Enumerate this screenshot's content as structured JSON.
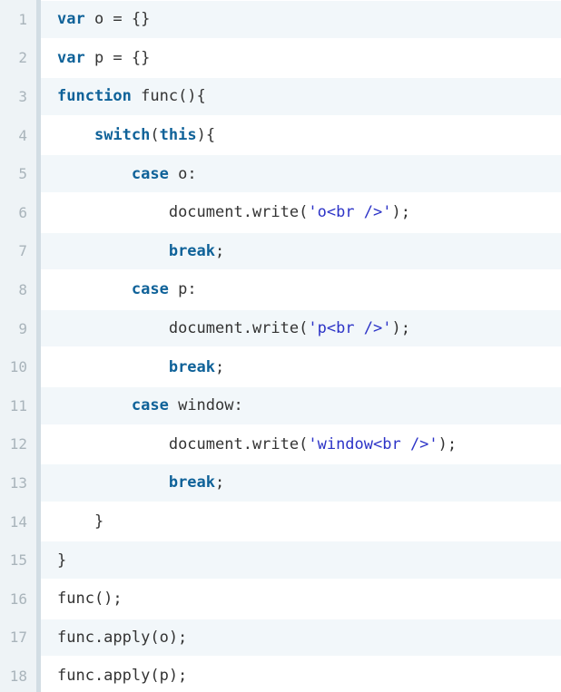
{
  "code": {
    "lines": [
      {
        "number": "1",
        "indent": "",
        "tokens": [
          {
            "type": "kw",
            "text": "var"
          },
          {
            "type": "plain",
            "text": " o = {}"
          }
        ]
      },
      {
        "number": "2",
        "indent": "",
        "tokens": [
          {
            "type": "kw",
            "text": "var"
          },
          {
            "type": "plain",
            "text": " p = {}"
          }
        ]
      },
      {
        "number": "3",
        "indent": "",
        "tokens": [
          {
            "type": "kw",
            "text": "function"
          },
          {
            "type": "plain",
            "text": " func(){"
          }
        ]
      },
      {
        "number": "4",
        "indent": "    ",
        "tokens": [
          {
            "type": "kw",
            "text": "switch"
          },
          {
            "type": "plain",
            "text": "("
          },
          {
            "type": "kw",
            "text": "this"
          },
          {
            "type": "plain",
            "text": "){"
          }
        ]
      },
      {
        "number": "5",
        "indent": "        ",
        "tokens": [
          {
            "type": "kw",
            "text": "case"
          },
          {
            "type": "plain",
            "text": " o:"
          }
        ]
      },
      {
        "number": "6",
        "indent": "            ",
        "tokens": [
          {
            "type": "plain",
            "text": "document.write("
          },
          {
            "type": "str",
            "text": "'o<br />'"
          },
          {
            "type": "plain",
            "text": ");"
          }
        ]
      },
      {
        "number": "7",
        "indent": "            ",
        "tokens": [
          {
            "type": "kw",
            "text": "break"
          },
          {
            "type": "plain",
            "text": ";"
          }
        ]
      },
      {
        "number": "8",
        "indent": "        ",
        "tokens": [
          {
            "type": "kw",
            "text": "case"
          },
          {
            "type": "plain",
            "text": " p:"
          }
        ]
      },
      {
        "number": "9",
        "indent": "            ",
        "tokens": [
          {
            "type": "plain",
            "text": "document.write("
          },
          {
            "type": "str",
            "text": "'p<br />'"
          },
          {
            "type": "plain",
            "text": ");"
          }
        ]
      },
      {
        "number": "10",
        "indent": "            ",
        "tokens": [
          {
            "type": "kw",
            "text": "break"
          },
          {
            "type": "plain",
            "text": ";"
          }
        ]
      },
      {
        "number": "11",
        "indent": "        ",
        "tokens": [
          {
            "type": "kw",
            "text": "case"
          },
          {
            "type": "plain",
            "text": " window:"
          }
        ]
      },
      {
        "number": "12",
        "indent": "            ",
        "tokens": [
          {
            "type": "plain",
            "text": "document.write("
          },
          {
            "type": "str",
            "text": "'window<br />'"
          },
          {
            "type": "plain",
            "text": ");"
          }
        ]
      },
      {
        "number": "13",
        "indent": "            ",
        "tokens": [
          {
            "type": "kw",
            "text": "break"
          },
          {
            "type": "plain",
            "text": ";"
          }
        ]
      },
      {
        "number": "14",
        "indent": "    ",
        "tokens": [
          {
            "type": "plain",
            "text": "}"
          }
        ]
      },
      {
        "number": "15",
        "indent": "",
        "tokens": [
          {
            "type": "plain",
            "text": "}"
          }
        ]
      },
      {
        "number": "16",
        "indent": "",
        "tokens": [
          {
            "type": "plain",
            "text": "func();"
          }
        ]
      },
      {
        "number": "17",
        "indent": "",
        "tokens": [
          {
            "type": "plain",
            "text": "func.apply(o);"
          }
        ]
      },
      {
        "number": "18",
        "indent": "",
        "tokens": [
          {
            "type": "plain",
            "text": "func.apply(p);"
          }
        ]
      }
    ]
  },
  "colors": {
    "keyword": "#0f6299",
    "string": "#2c33c7",
    "text": "#333333",
    "line_number": "#a9b4bb",
    "gutter_bg": "#eef3f6",
    "alt_row_bg": "#f2f7fa"
  }
}
